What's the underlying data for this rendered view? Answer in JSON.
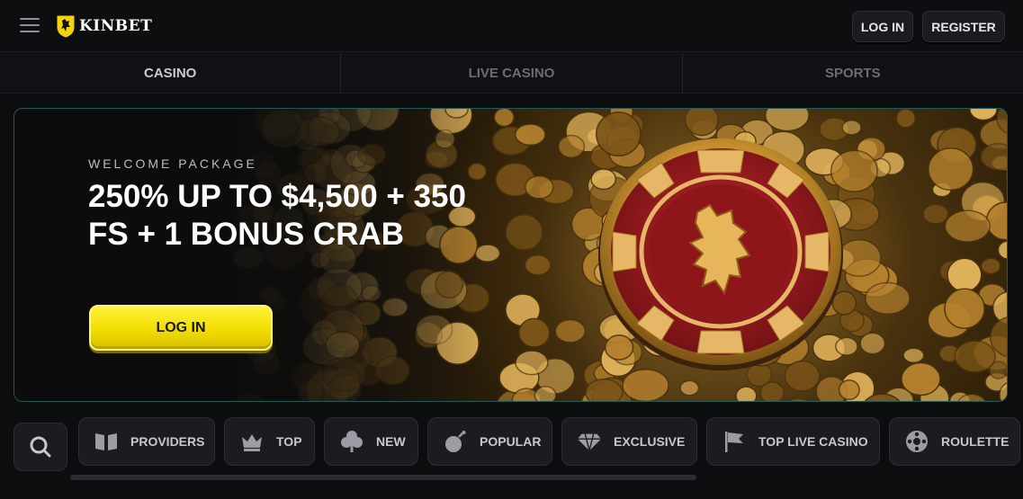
{
  "header": {
    "brand": "KINBET",
    "login_label": "LOG IN",
    "register_label": "REGISTER"
  },
  "tabs": [
    {
      "label": "CASINO",
      "active": true
    },
    {
      "label": "LIVE CASINO",
      "active": false
    },
    {
      "label": "SPORTS",
      "active": false
    }
  ],
  "banner": {
    "eyebrow": "WELCOME PACKAGE",
    "headline": "250% UP TO $4,500 + 350 FS + 1 BONUS CRAB",
    "cta_label": "LOG IN"
  },
  "categories": [
    {
      "label": "PROVIDERS",
      "icon": "book-icon"
    },
    {
      "label": "TOP",
      "icon": "crown-icon"
    },
    {
      "label": "NEW",
      "icon": "clover-icon"
    },
    {
      "label": "POPULAR",
      "icon": "bomb-icon"
    },
    {
      "label": "EXCLUSIVE",
      "icon": "diamond-icon"
    },
    {
      "label": "TOP LIVE CASINO",
      "icon": "flag-icon"
    },
    {
      "label": "ROULETTE",
      "icon": "roulette-icon"
    }
  ],
  "colors": {
    "accent_yellow": "#f2de00",
    "banner_border": "#1f5a58",
    "chip_red": "#9e1b20",
    "gold": "#d9a441"
  }
}
